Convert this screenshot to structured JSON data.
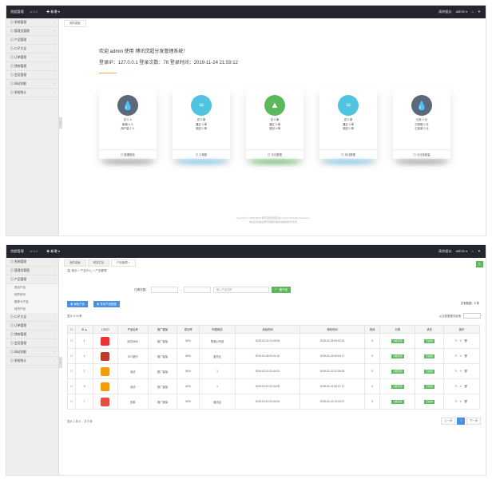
{
  "header": {
    "logo": "贷超管理",
    "version": "v2.0.0",
    "new_label": "✚ 新增 ▾",
    "clear_cache": "清除缓存",
    "user": "admin ▾",
    "home_icon": "home-icon",
    "shirt_icon": "theme-icon"
  },
  "sidebar1": [
    {
      "label": "系统管理"
    },
    {
      "label": "管理员管理"
    },
    {
      "label": "产品管理"
    },
    {
      "label": "口子大全"
    },
    {
      "label": "订单管理"
    },
    {
      "label": "贷款管理"
    },
    {
      "label": "会员管理"
    },
    {
      "label": "网站功能"
    },
    {
      "label": "系统统计"
    }
  ],
  "sidebar2": {
    "before": [
      {
        "label": "系统管理"
      },
      {
        "label": "管理员管理"
      },
      {
        "label": "产品管理"
      }
    ],
    "sub": [
      "首页产品",
      "网贷系列",
      "推荐卡产品",
      "信贷产品"
    ],
    "after": [
      {
        "label": "口子大全"
      },
      {
        "label": "订单管理"
      },
      {
        "label": "贷款管理"
      },
      {
        "label": "会员管理"
      },
      {
        "label": "网站功能"
      },
      {
        "label": "系统统计"
      }
    ]
  },
  "tabs1": [
    "我的桌面"
  ],
  "tabs2": [
    "我的桌面",
    "网站栏目",
    "产品管理 ×"
  ],
  "dashboard": {
    "welcome": "欢迎 admin 使用 博讯贷超分发管理系统！",
    "info": "登录IP：127.0.0.1 登录次数：76 登录时间：2019-11-24 21:59:12",
    "cards": [
      {
        "icon": "drop-icon",
        "color": "#5a6a7a",
        "glow": "#999",
        "lines": [
          "总 0 人",
          "新增 0 人",
          "用户量 0 人"
        ],
        "foot": "▤ 数据报告"
      },
      {
        "icon": "waves-icon",
        "color": "#4fc3e0",
        "glow": "#6cc8f0",
        "lines": [
          "总 0 单",
          "通过 0 单",
          "驳回 0 单"
        ],
        "foot": "▤ 订单数"
      },
      {
        "icon": "tree-icon",
        "color": "#5cb85c",
        "glow": "#5cb85c",
        "lines": [
          "总 0 单",
          "通过 0 单",
          "驳回 0 单"
        ],
        "foot": "▤ 今日数据"
      },
      {
        "icon": "waves-icon",
        "color": "#4fc3e0",
        "glow": "#6cc8f0",
        "lines": [
          "总 0 单",
          "通过 0 单",
          "驳回 0 单"
        ],
        "foot": "▤ 本日数据"
      },
      {
        "icon": "drop-icon",
        "color": "#5a6a7a",
        "glow": "#999",
        "lines": [
          "日总 0 元",
          "已到账 0 元",
          "已还款 0 元"
        ],
        "foot": "▤ 今日放款量"
      }
    ],
    "copyright": "Copyright © 2018-2019 博讯贷超管理系统 v2.0.0 All Rights Reserved.",
    "copyright2": "本后台系统由博讯贷超管理系统提供技术支持"
  },
  "products": {
    "breadcrumb": "🏠 首页 > 产品中心 > 产品管理",
    "date_label": "日期范围：",
    "date_from": "",
    "date_to": "",
    "search_placeholder": "输入产品名称",
    "search_btn": "🔍 搜产品",
    "batch_delete": "✚ 添加产品",
    "add_btn": "✚ 导出产品数据",
    "total": "共有数据：5 条",
    "show": "显示 10 ▾ 条",
    "search_label": "从当前数据中检索:",
    "columns": [
      "",
      "ID ▲",
      "LOGO",
      "产品名称",
      "推广链接",
      "成功率",
      "所属网站",
      "添加时间",
      "修改时间",
      "排序",
      "分类",
      "状态",
      "操作"
    ],
    "rows": [
      {
        "id": "1",
        "logo_color": "#e33",
        "name": "测试0844",
        "link": "推广链接",
        "rate": "50%",
        "site": "思源公司官",
        "add": "2019-02-21 01:23:34",
        "mod": "2019-02-26 09:02:20",
        "sort": "0",
        "cat": "小额贷款",
        "status": "已启用",
        "ops": "✎ ✐ 🗑"
      },
      {
        "id": "4",
        "logo_color": "#c0392b",
        "name": "中介银行",
        "link": "推广链接",
        "rate": "80%",
        "site": "重开区",
        "add": "2019-02-26 09:01:10",
        "mod": "2019-02-26 09:00:17",
        "sort": "0",
        "cat": "小额贷款",
        "status": "已启用",
        "ops": "✎ ✐ 🗑"
      },
      {
        "id": "2",
        "logo_color": "#f39c12",
        "name": "测试",
        "link": "推广链接",
        "rate": "50%",
        "site": "1",
        "add": "2019-02-19 22:44:01",
        "mod": "2019-02-22 12:05:25",
        "sort": "0",
        "cat": "小额贷款",
        "status": "已启用",
        "ops": "✎ ✐ 🗑"
      },
      {
        "id": "3",
        "logo_color": "#f39c12",
        "name": "测试",
        "link": "推广链接",
        "rate": "50%",
        "site": "1",
        "add": "2019-02-19 22:44:00",
        "mod": "2019-02-22 05:07:17",
        "sort": "0",
        "cat": "小额贷款",
        "status": "已启用",
        "ops": "✎ ✐ 🗑"
      },
      {
        "id": "7",
        "logo_color": "#e74c3c",
        "name": "宜泰",
        "link": "推广链接",
        "rate": "50%",
        "site": "重庆区",
        "add": "2019-02-19 22:44:01",
        "mod": "2019-02-22 13:02:07",
        "sort": "0",
        "cat": "小额贷款",
        "status": "已启用",
        "ops": "✎ ✐ 🗑"
      }
    ],
    "pagination": "显示 1 到 5 ，共 5 条",
    "prev": "上一页",
    "page": "1",
    "next": "下一页"
  }
}
